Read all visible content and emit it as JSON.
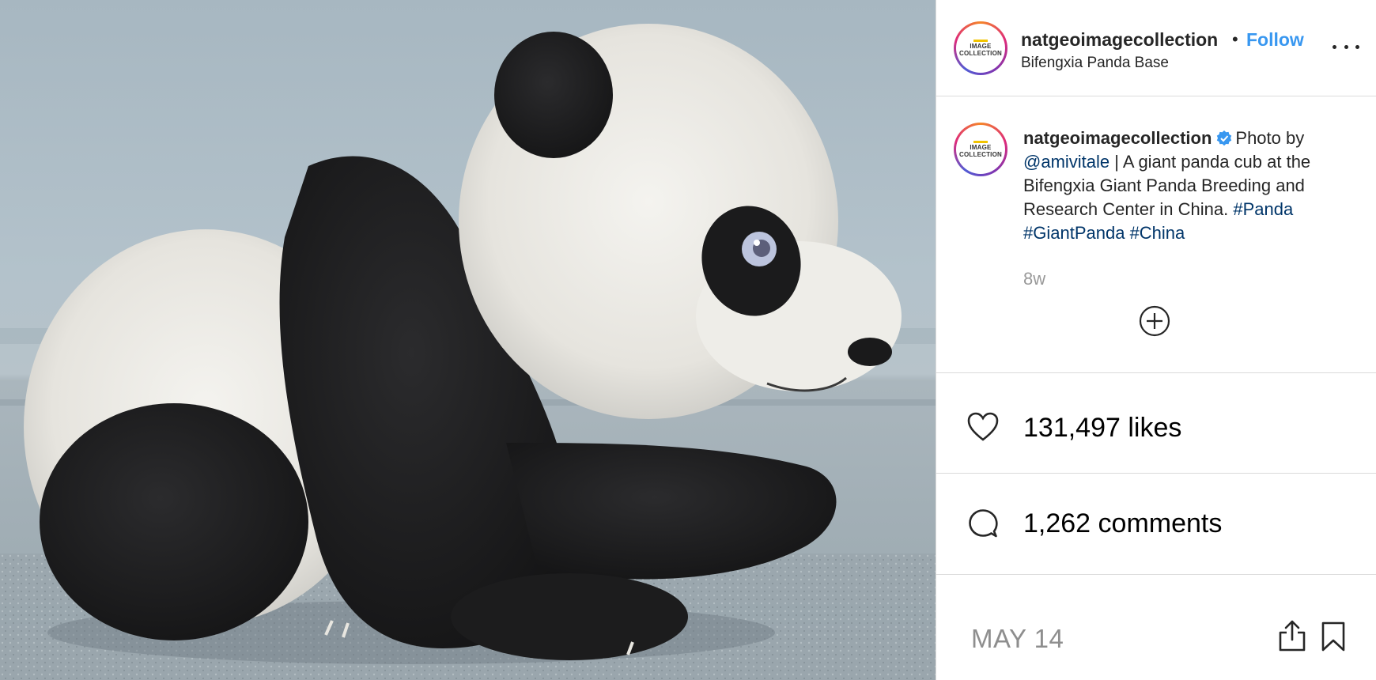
{
  "post": {
    "image_alt": "Giant panda cub",
    "author": {
      "username": "natgeoimagecollection",
      "avatar_text_line1": "IMAGE",
      "avatar_text_line2": "COLLECTION"
    },
    "follow_separator": "•",
    "follow_label": "Follow",
    "location": "Bifengxia Panda Base",
    "caption": {
      "username": "natgeoimagecollection",
      "verified": true,
      "text_before_mention": "Photo by",
      "mention": "@amivitale",
      "text_after_mention": " | A giant panda cub at the Bifengxia Giant Panda Breeding and Research Center in China. ",
      "hashtags": [
        "#Panda",
        "#GiantPanda",
        "#China"
      ]
    },
    "age": "8w",
    "likes": "131,497 likes",
    "comments": "1,262 comments",
    "date": "MAY 14"
  },
  "colors": {
    "follow": "#3897f0",
    "hashtag": "#003569",
    "muted": "#8e8e8e",
    "verified": "#3897f0"
  },
  "icons": {
    "more": "more-options-icon",
    "add": "plus-circle-icon",
    "like": "heart-icon",
    "comment": "comment-bubble-icon",
    "share": "share-icon",
    "save": "bookmark-icon"
  }
}
